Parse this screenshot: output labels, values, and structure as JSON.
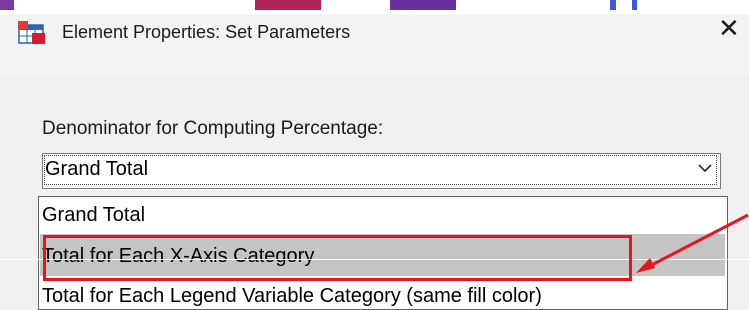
{
  "dialog": {
    "title": "Element Properties: Set Parameters",
    "icon": "app-table-icon",
    "close_icon": "close-icon"
  },
  "field": {
    "label": "Denominator for Computing Percentage:",
    "selected_value": "Grand Total"
  },
  "dropdown": {
    "options": [
      "Grand Total",
      "Total for Each X-Axis Category",
      "Total for Each Legend Variable Category (same fill color)"
    ],
    "highlighted_index": 1
  },
  "colors": {
    "highlight": "#c4c4c4",
    "annotation": "#e8141c"
  }
}
